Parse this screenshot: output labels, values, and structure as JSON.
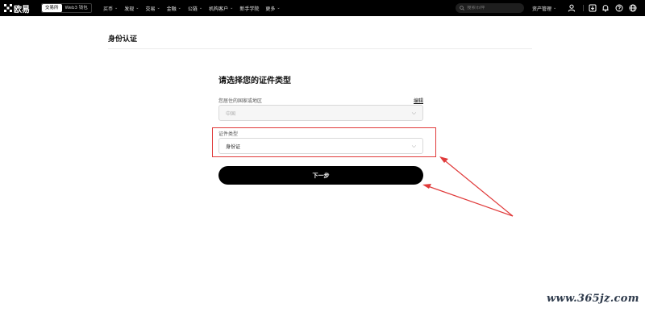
{
  "topbar": {
    "brand": "欧易",
    "mode_tabs": [
      "交易所",
      "Web3 钱包"
    ],
    "nav": [
      {
        "label": "买币",
        "has_dropdown": true
      },
      {
        "label": "发现",
        "has_dropdown": true
      },
      {
        "label": "交易",
        "has_dropdown": true
      },
      {
        "label": "金融",
        "has_dropdown": true
      },
      {
        "label": "公链",
        "has_dropdown": true
      },
      {
        "label": "机构客户",
        "has_dropdown": true
      },
      {
        "label": "新手学院",
        "has_dropdown": false
      },
      {
        "label": "更多",
        "has_dropdown": true
      }
    ],
    "search_placeholder": "搜索币种",
    "asset_menu": "资产管理",
    "icons": [
      "user-icon",
      "download-icon",
      "bell-icon",
      "help-icon",
      "globe-icon"
    ],
    "bg_color": "#000000"
  },
  "page": {
    "title": "身份认证"
  },
  "form": {
    "title": "请选择您的证件类型",
    "country_label": "您居住的国家或地区",
    "edit_link": "编辑",
    "country_value": "中国",
    "id_type_label": "证件类型",
    "id_type_value": "身份证",
    "next_button": "下一步"
  },
  "annotation": {
    "highlight_color": "#e03a3a"
  },
  "watermark": "www.365jz.com"
}
